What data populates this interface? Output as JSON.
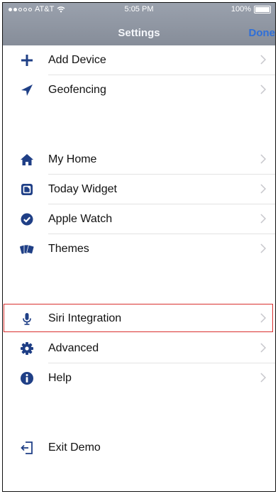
{
  "status": {
    "carrier": "AT&T",
    "time": "5:05 PM",
    "battery": "100%"
  },
  "nav": {
    "title": "Settings",
    "done": "Done"
  },
  "sections": [
    [
      {
        "label": "Add Device",
        "icon": "plus-icon"
      },
      {
        "label": "Geofencing",
        "icon": "location-arrow-icon"
      }
    ],
    [
      {
        "label": "My Home",
        "icon": "home-icon"
      },
      {
        "label": "Today Widget",
        "icon": "widget-icon"
      },
      {
        "label": "Apple Watch",
        "icon": "watch-check-icon"
      },
      {
        "label": "Themes",
        "icon": "themes-cards-icon"
      }
    ],
    [
      {
        "label": "Siri Integration",
        "icon": "microphone-icon"
      },
      {
        "label": "Advanced",
        "icon": "gear-icon"
      },
      {
        "label": "Help",
        "icon": "info-icon"
      }
    ],
    [
      {
        "label": "Exit Demo",
        "icon": "exit-icon"
      }
    ]
  ],
  "colors": {
    "icon": "#1f3f86",
    "highlight": "#d9302e",
    "done": "#2f6fd8"
  }
}
